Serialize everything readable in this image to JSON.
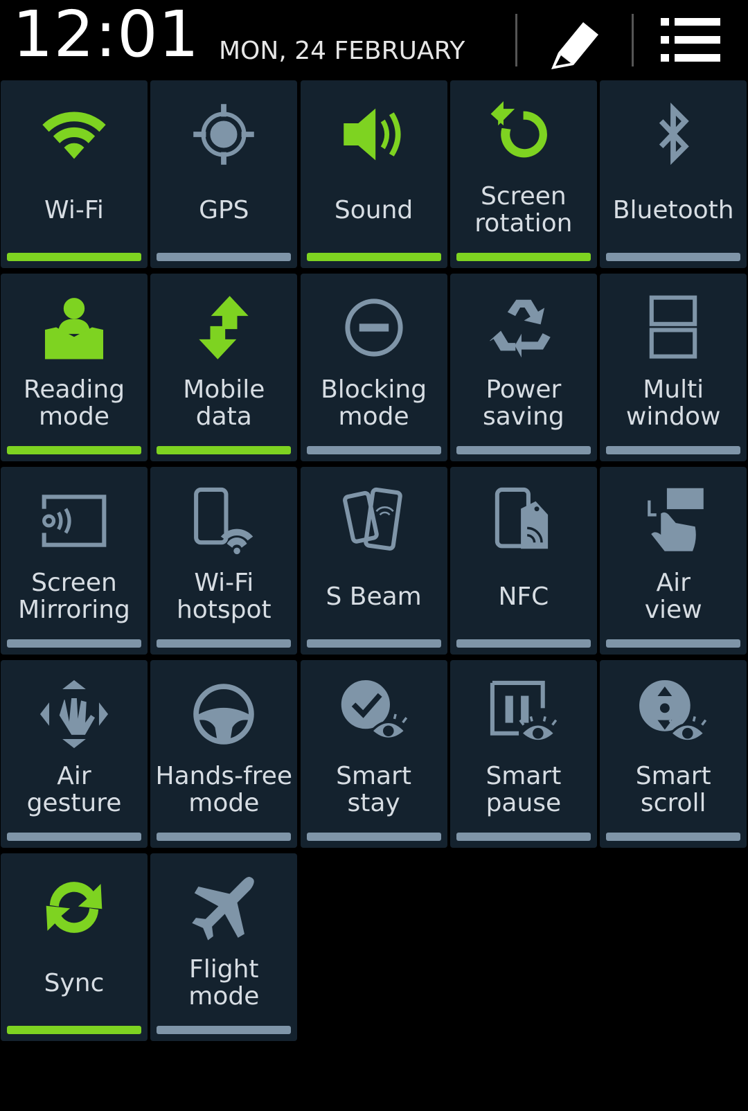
{
  "status": {
    "time": "12:01",
    "date": "MON, 24 FEBRUARY"
  },
  "colors": {
    "on": "#7ed321",
    "off": "#7f95a8",
    "tile_bg": "#14222e"
  },
  "icons": {
    "edit": "pencil-icon",
    "list": "list-icon"
  },
  "tiles": [
    {
      "label": "Wi-Fi",
      "icon": "wifi-icon",
      "on": true
    },
    {
      "label": "GPS",
      "icon": "gps-icon",
      "on": false
    },
    {
      "label": "Sound",
      "icon": "speaker-icon",
      "on": true
    },
    {
      "label": "Screen\nrotation",
      "icon": "rotation-icon",
      "on": true
    },
    {
      "label": "Bluetooth",
      "icon": "bluetooth-icon",
      "on": false
    },
    {
      "label": "Reading\nmode",
      "icon": "reading-icon",
      "on": true
    },
    {
      "label": "Mobile\ndata",
      "icon": "mobile-data-icon",
      "on": true
    },
    {
      "label": "Blocking\nmode",
      "icon": "blocking-icon",
      "on": false
    },
    {
      "label": "Power\nsaving",
      "icon": "recycle-icon",
      "on": false
    },
    {
      "label": "Multi\nwindow",
      "icon": "multi-window-icon",
      "on": false
    },
    {
      "label": "Screen\nMirroring",
      "icon": "screen-mirroring-icon",
      "on": false
    },
    {
      "label": "Wi-Fi\nhotspot",
      "icon": "hotspot-icon",
      "on": false
    },
    {
      "label": "S Beam",
      "icon": "s-beam-icon",
      "on": false
    },
    {
      "label": "NFC",
      "icon": "nfc-icon",
      "on": false
    },
    {
      "label": "Air\nview",
      "icon": "air-view-icon",
      "on": false
    },
    {
      "label": "Air\ngesture",
      "icon": "air-gesture-icon",
      "on": false
    },
    {
      "label": "Hands-free\nmode",
      "icon": "steering-wheel-icon",
      "on": false
    },
    {
      "label": "Smart\nstay",
      "icon": "smart-stay-icon",
      "on": false
    },
    {
      "label": "Smart\npause",
      "icon": "smart-pause-icon",
      "on": false
    },
    {
      "label": "Smart\nscroll",
      "icon": "smart-scroll-icon",
      "on": false
    },
    {
      "label": "Sync",
      "icon": "sync-icon",
      "on": true
    },
    {
      "label": "Flight\nmode",
      "icon": "airplane-icon",
      "on": false
    }
  ]
}
